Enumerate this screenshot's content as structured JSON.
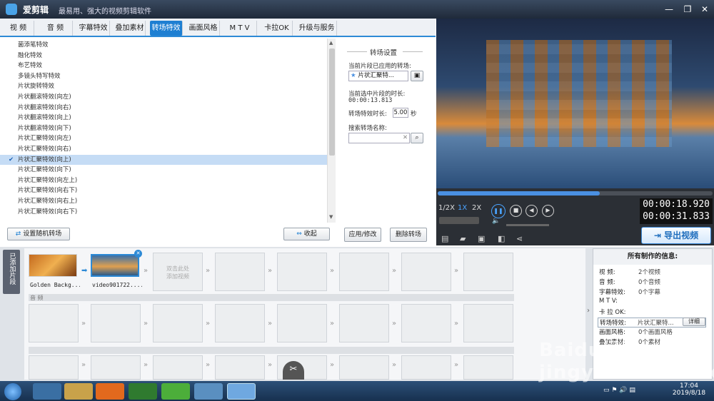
{
  "app": {
    "name": "爱剪辑",
    "slogan": "最易用、强大的视频剪辑软件"
  },
  "tabs": [
    "视 频",
    "音 频",
    "字幕特效",
    "叠加素材",
    "转场特效",
    "画面风格",
    "M T V",
    "卡拉OK",
    "升级与服务"
  ],
  "active_tab_index": 4,
  "transitions": [
    "菌添笔特效",
    "融化特效",
    "布艺特效",
    "多镜头特写特效",
    "片状旋转特效",
    "片状翻滚特效(向左)",
    "片状翻滚特效(向右)",
    "片状翻滚特效(向上)",
    "片状翻滚特效(向下)",
    "片状汇聚特效(向左)",
    "片状汇聚特效(向右)",
    "片状汇聚特效(向上)",
    "片状汇聚特效(向下)",
    "片状汇聚特效(向左上)",
    "片状汇聚特效(向右下)",
    "片状汇聚特效(向右上)",
    "片状汇聚特效(向右下)"
  ],
  "selected_transition_index": 11,
  "settings": {
    "title": "转场设置",
    "applied_label": "当前片段已应用的转场:",
    "applied_value": "片状汇聚特...",
    "duration_label": "当前选中片段的时长:",
    "duration_value": "00:00:13.813",
    "effect_duration_label": "转场特效时长:",
    "effect_duration_value": "5.00",
    "effect_duration_unit": "秒",
    "search_label": "搜索转场名称:",
    "search_value": "",
    "apply_btn": "应用/修改",
    "delete_btn": "删除转场"
  },
  "random_btn": "设置随机转场",
  "collapse_btn": "收起",
  "player": {
    "speeds": [
      "1/2X",
      "1X",
      "2X"
    ],
    "current_time": "00:00:18.920",
    "total_time": "00:00:31.833",
    "progress": 0.59
  },
  "export_btn": "导出视频",
  "added_clips_label": "已添加片段",
  "clips": [
    {
      "name": "Golden Backg..."
    },
    {
      "name": "video901722...."
    }
  ],
  "add_clip_hint": "双击此处\n添加视频",
  "audio_label": "音 频",
  "info": {
    "title": "所有制作的信息:",
    "rows": [
      [
        "视    频:",
        "2个视频"
      ],
      [
        "音    频:",
        "0个音频"
      ],
      [
        "字幕特效:",
        "0个字幕"
      ],
      [
        "M  T  V:",
        ""
      ],
      [
        "卡 拉 OK:",
        ""
      ],
      [
        "转场特效:",
        "片状汇聚特..."
      ],
      [
        "画面风格:",
        "0个画面风格"
      ],
      [
        "叠加素材:",
        "0个素材"
      ]
    ],
    "detail_btn": "详细"
  },
  "taskbar": {
    "time": "17:04",
    "date": "2019/8/18"
  },
  "watermark": "Baidu经验 jingyan.baidu.com"
}
